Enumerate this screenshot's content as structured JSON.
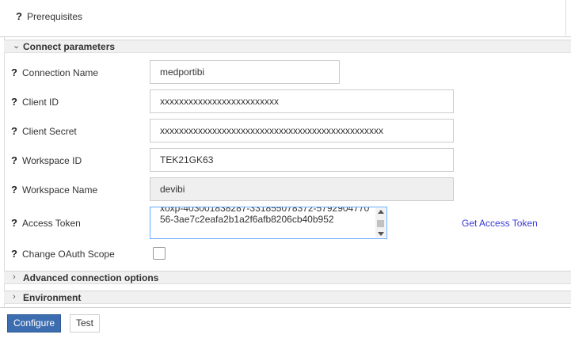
{
  "prerequisites": {
    "label": "Prerequisites"
  },
  "sections": {
    "connect": {
      "title": "Connect parameters"
    },
    "advanced": {
      "title": "Advanced connection options"
    },
    "environment": {
      "title": "Environment"
    }
  },
  "help_glyph": "?",
  "fields": {
    "connection_name": {
      "label": "Connection Name",
      "value": "medportibi"
    },
    "client_id": {
      "label": "Client ID",
      "value": "xxxxxxxxxxxxxxxxxxxxxxxxx"
    },
    "client_secret": {
      "label": "Client Secret",
      "value": "xxxxxxxxxxxxxxxxxxxxxxxxxxxxxxxxxxxxxxxxxxxxxxx"
    },
    "workspace_id": {
      "label": "Workspace ID",
      "value": "TEK21GK63"
    },
    "workspace_name": {
      "label": "Workspace Name",
      "value": "devibi"
    },
    "access_token": {
      "label": "Access Token",
      "value": "xoxp-403001838287-331855078372-579290477056-3ae7c2eafa2b1a2f6afb8206cb40b952"
    },
    "change_oauth_scope": {
      "label": "Change OAuth Scope",
      "checked": false
    }
  },
  "get_access_token": {
    "label": "Get Access Token"
  },
  "buttons": {
    "configure": "Configure",
    "test": "Test"
  },
  "colors": {
    "primary": "#3c6db0",
    "link": "#3a3ad6",
    "focus_border": "#66aaff"
  }
}
